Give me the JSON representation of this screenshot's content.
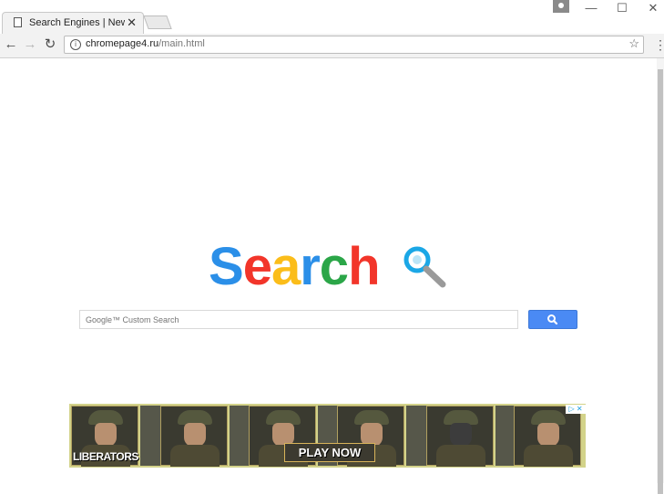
{
  "browser": {
    "tab_title": "Search Engines | News sc",
    "tab_close": "✕",
    "url_domain": "chromepage4.ru",
    "url_path": "/main.html",
    "window_controls": {
      "minimize": "—",
      "maximize": "☐",
      "close": "✕"
    },
    "nav": {
      "back": "←",
      "forward": "→",
      "reload": "↻",
      "info": "i",
      "bookmark": "☆",
      "menu": "⋮"
    }
  },
  "logo": {
    "letters": [
      {
        "char": "S",
        "color": "#2b8fe8"
      },
      {
        "char": "e",
        "color": "#f2352a"
      },
      {
        "char": "a",
        "color": "#fbbd1a"
      },
      {
        "char": "r",
        "color": "#2b8fe8"
      },
      {
        "char": "c",
        "color": "#2ba648"
      },
      {
        "char": "h",
        "color": "#f2352a"
      }
    ],
    "icon": "magnifier-icon",
    "icon_colors": {
      "ring": "#1ba7e6",
      "handle": "#9a9a9a"
    }
  },
  "search": {
    "placeholder": "Google™ Custom Search",
    "button_icon": "search-icon",
    "button_color": "#4a8af4"
  },
  "ad": {
    "left_text": "LIBERATORS",
    "cta": "PLAY NOW",
    "adchoices_icon": "adchoices-icon",
    "adchoices_text": "▷ ✕"
  }
}
